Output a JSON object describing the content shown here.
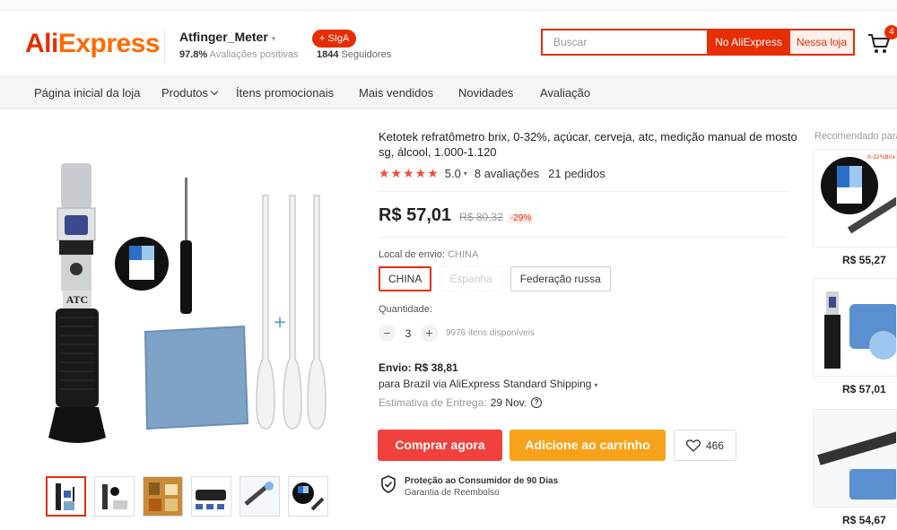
{
  "brand": {
    "logo_red": "Ali",
    "logo_orange": "Express"
  },
  "store": {
    "name": "Atfinger_Meter",
    "rating_value": "97.8%",
    "rating_label": "Avaliações positivas",
    "follow_label": "+ SIgA",
    "followers_count": "1844",
    "followers_label": "Seguidores"
  },
  "search": {
    "placeholder": "Buscar",
    "btn_aliexpress": "No AliExpress",
    "btn_store": "Nessa loja"
  },
  "cart": {
    "count": "4",
    "icon": "cart-icon"
  },
  "nav": {
    "items": [
      {
        "label": "Página inicial da loja"
      },
      {
        "label": "Produtos"
      },
      {
        "label": "Ítens promocionais"
      },
      {
        "label": "Mais vendidos"
      },
      {
        "label": "Novidades"
      },
      {
        "label": "Avaliação"
      }
    ]
  },
  "product": {
    "title": "Ketotek refratômetro brix, 0-32%, açúcar, cerveja, atc, medição manual de mosto sg, álcool, 1.000-1.120",
    "stars": "★★★★★",
    "score": "5.0",
    "reviews": "8 avaliações",
    "orders": "21 pedidos",
    "price": "R$ 57,01",
    "old_price": "R$ 80,32",
    "discount": "-29%",
    "image_label": "ATC",
    "plus_sign": "+",
    "thumb_label": "ATC",
    "ship_from_label": "Local de envio:",
    "ship_from_value": "CHINA",
    "ship_options": [
      {
        "label": "CHINA",
        "state": "selected"
      },
      {
        "label": "Espanha",
        "state": "disabled"
      },
      {
        "label": "Federação russa",
        "state": "normal"
      }
    ],
    "qty_label": "Quantidade:",
    "qty_minus": "−",
    "qty_plus": "+",
    "qty_value": "3",
    "qty_available": "9976 itens disponíveis",
    "shipping_price": "Envio: R$ 38,81",
    "shipping_via": "para Brazil via AliExpress Standard Shipping",
    "delivery_label": "Estimativa de Entrega:",
    "delivery_date": "29 Nov.",
    "buy_now": "Comprar agora",
    "add_cart": "Adicione ao carrinho",
    "wishlist_count": "466",
    "protection_title": "Proteção ao Consumidor de 90 Dias",
    "protection_sub": "Garantia de Reembolso"
  },
  "recommended": {
    "title": "Recomendado para você",
    "items": [
      {
        "price": "R$ 55,27",
        "caption": "0-32%Brix"
      },
      {
        "price": "R$ 57,01",
        "caption": ""
      },
      {
        "price": "R$ 54,67",
        "caption": ""
      }
    ]
  },
  "colors": {
    "accent": "#e62e04",
    "buy": "#f0413c",
    "cart": "#f7a21b",
    "stars": "#f04b3a"
  }
}
